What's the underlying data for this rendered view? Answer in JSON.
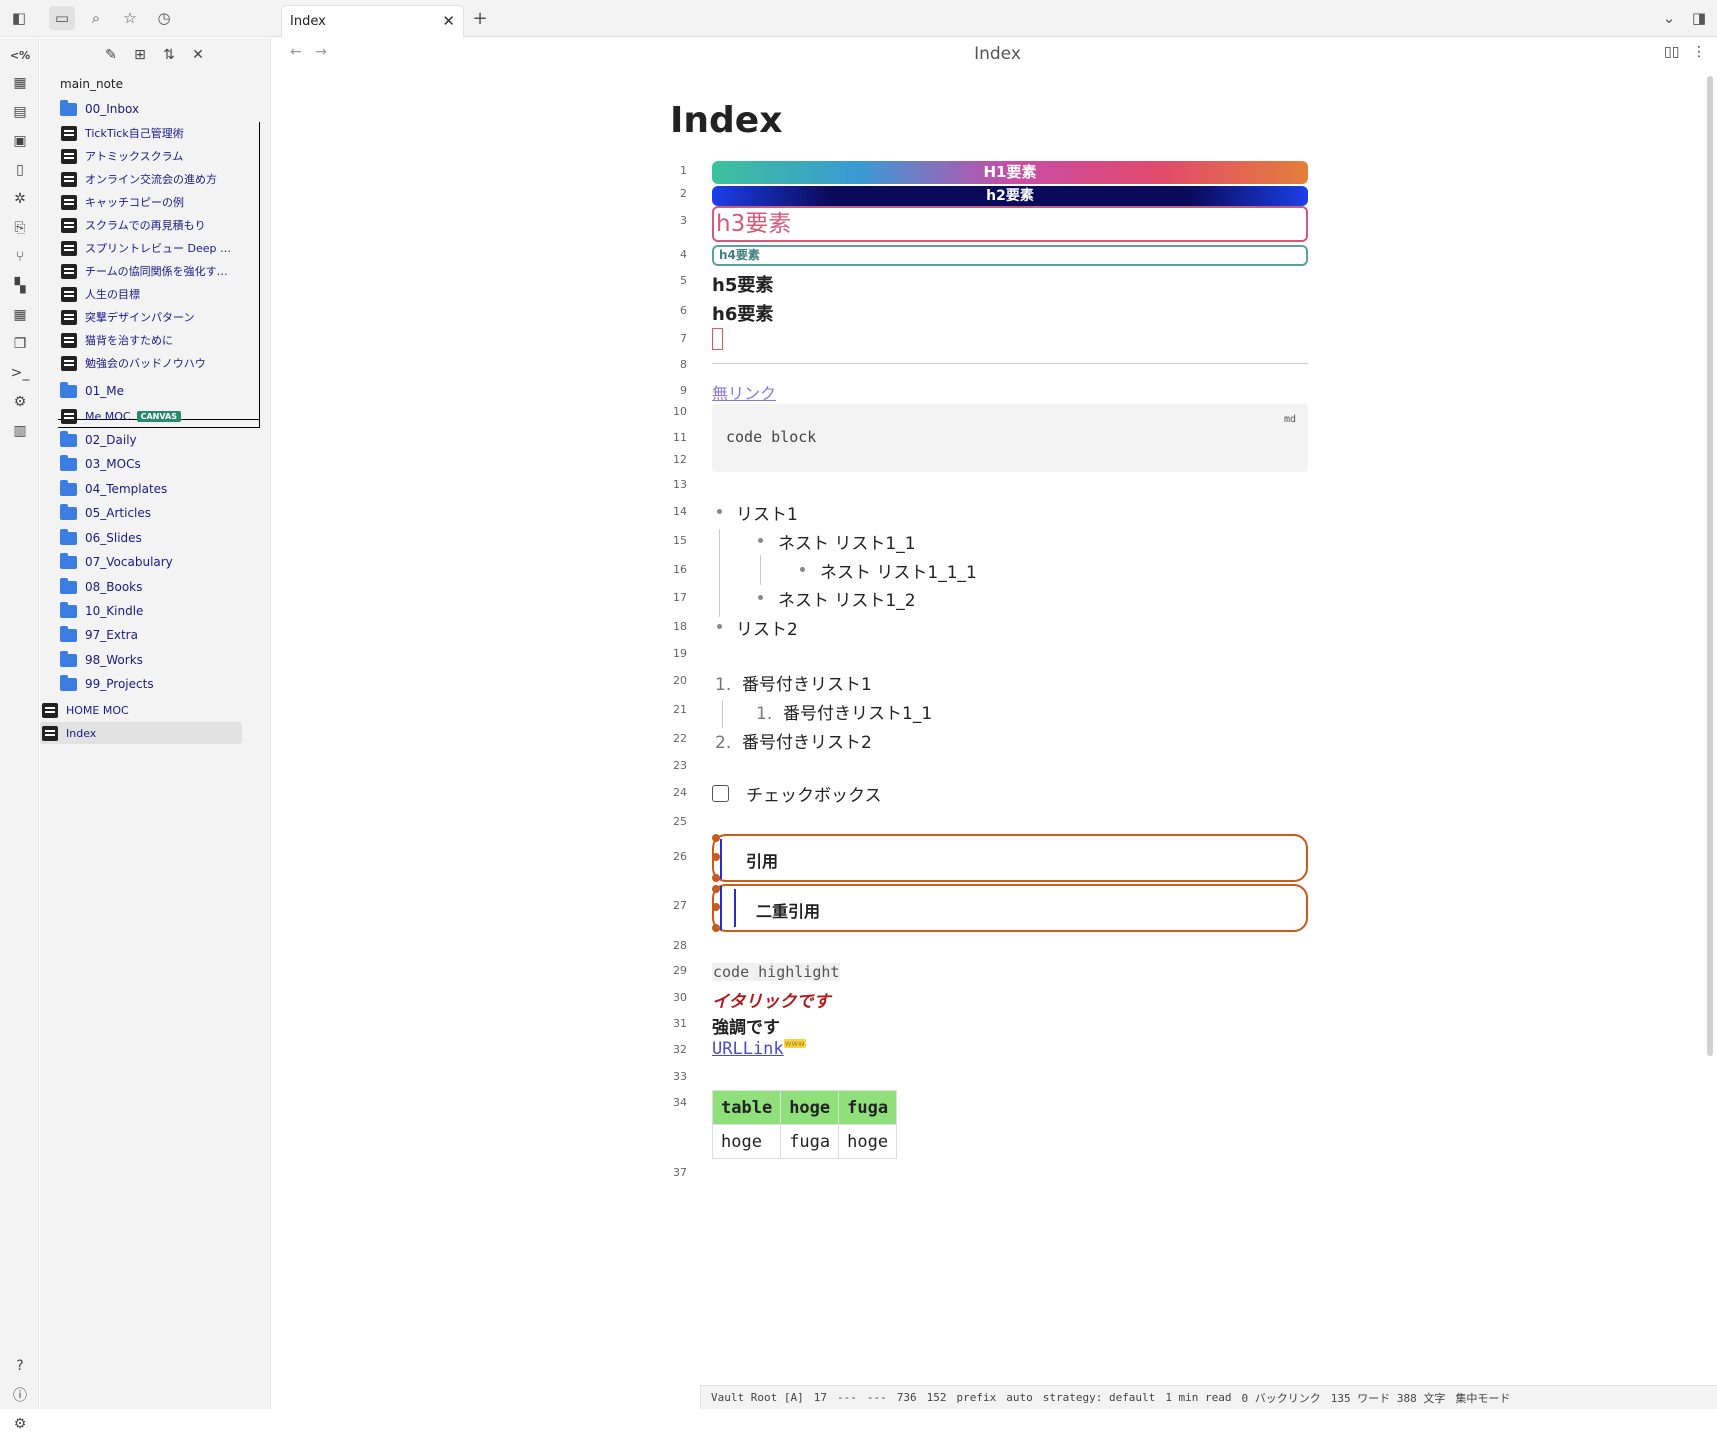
{
  "topbar": {
    "tab_title": "Index",
    "new_tab": "+"
  },
  "sidebar": {
    "vault_name": "main_note",
    "folders": {
      "inbox": "00_Inbox",
      "me": "01_Me",
      "daily": "02_Daily",
      "mocs": "03_MOCs",
      "templates": "04_Templates",
      "articles": "05_Articles",
      "slides": "06_Slides",
      "vocabulary": "07_Vocabulary",
      "books": "08_Books",
      "kindle": "10_Kindle",
      "extra": "97_Extra",
      "works": "98_Works",
      "projects": "99_Projects"
    },
    "inbox_files": [
      "TickTick自己管理術",
      "アトミックスクラム",
      "オンライン交流会の進め方",
      "キャッチコピーの例",
      "スクラムでの再見積もり",
      "スプリントレビュー Deep …",
      "チームの協同関係を強化す…",
      "人生の目標",
      "突撃デザインパターン",
      "猫背を治すために",
      "勉強会のバッドノウハウ"
    ],
    "me_file": "Me MOC",
    "me_badge": "CANVAS",
    "root_files": [
      "HOME MOC",
      "Index"
    ]
  },
  "view": {
    "title": "Index",
    "note_title": "Index"
  },
  "editor": {
    "line_numbers": [
      "1",
      "2",
      "3",
      "4",
      "5",
      "6",
      "7",
      "8",
      "9",
      "10",
      "11",
      "12",
      "13",
      "14",
      "15",
      "16",
      "17",
      "18",
      "19",
      "20",
      "21",
      "22",
      "23",
      "24",
      "25",
      "26",
      "27",
      "28",
      "29",
      "30",
      "31",
      "32",
      "33",
      "34",
      "37"
    ],
    "h1": "H1要素",
    "h2": "h2要素",
    "h3": "h3要素",
    "h4": "h4要素",
    "h5": "h5要素",
    "h6": "h6要素",
    "broken_link": "無リンク",
    "code_block": "code block",
    "code_lang": "md",
    "list": {
      "l1": "リスト1",
      "l1_1": "ネスト リスト1_1",
      "l1_1_1": "ネスト リスト1_1_1",
      "l1_2": "ネスト リスト1_2",
      "l2": "リスト2"
    },
    "ordered": {
      "n1_num": "1.",
      "n1": "番号付きリスト1",
      "n1_1_num": "1.",
      "n1_1": "番号付きリスト1_1",
      "n2_num": "2.",
      "n2": "番号付きリスト2"
    },
    "checkbox": "チェックボックス",
    "quote": "引用",
    "double_quote": "二重引用",
    "code_highlight": "code highlight",
    "italic": "イタリックです",
    "strong": "強調です",
    "url_link": "URLLink",
    "url_badge": "www",
    "table": {
      "header": [
        "table",
        "hoge",
        "fuga"
      ],
      "rows": [
        [
          "hoge",
          "fuga",
          "hoge"
        ]
      ]
    }
  },
  "status": {
    "vault_root": "Vault Root [A]",
    "s1": "17",
    "s2": "---",
    "s3": "---",
    "s4": "736",
    "s5": "152",
    "prefix": "prefix",
    "auto": "auto",
    "strategy": "strategy: default",
    "read": "1 min read",
    "backlinks": "0 バックリンク",
    "counts": "135 ワード 388 文字",
    "focus": "集中モード"
  }
}
